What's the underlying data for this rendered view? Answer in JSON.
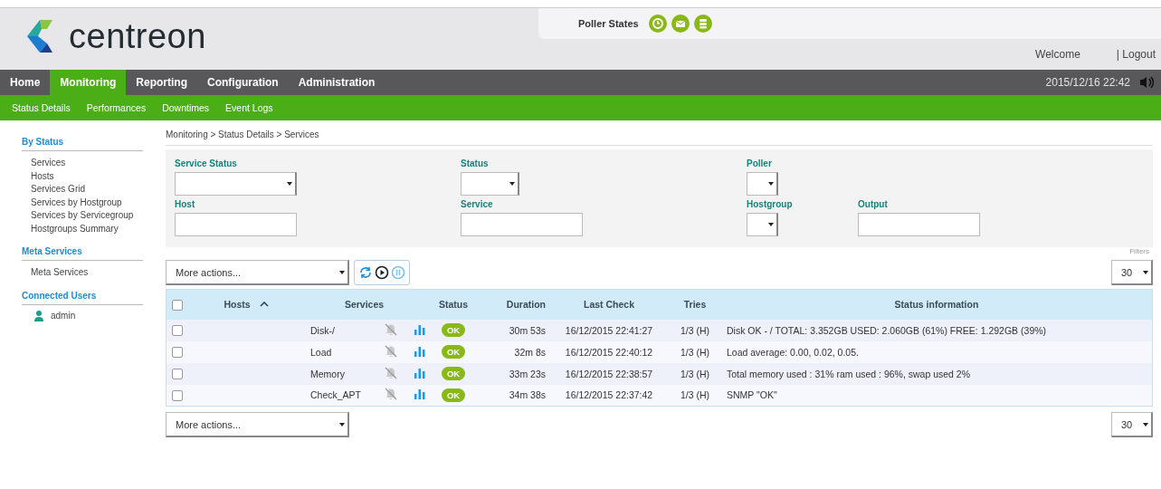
{
  "header": {
    "logo_text": "centreon",
    "poller_states": {
      "label": "Poller States"
    },
    "welcome": "Welcome",
    "logout": "| Logout"
  },
  "main_menu": [
    {
      "label": "Home",
      "selected": false
    },
    {
      "label": "Monitoring",
      "selected": true
    },
    {
      "label": "Reporting",
      "selected": false
    },
    {
      "label": "Configuration",
      "selected": false
    },
    {
      "label": "Administration",
      "selected": false
    }
  ],
  "clock": "2015/12/16 22:42",
  "sub_menu": [
    "Status Details",
    "Performances",
    "Downtimes",
    "Event Logs"
  ],
  "sidebar": [
    {
      "title": "By Status",
      "items": [
        "Services",
        "Hosts",
        "Services Grid",
        "Services by Hostgroup",
        "Services by Servicegroup",
        "Hostgroups Summary"
      ]
    },
    {
      "title": "Meta Services",
      "items": [
        "Meta Services"
      ]
    },
    {
      "title": "Connected Users",
      "users": [
        "admin"
      ]
    }
  ],
  "breadcrumb": "Monitoring > Status Details > Services",
  "filters": [
    {
      "label": "Service Status",
      "kind": "select"
    },
    {
      "label": "Status",
      "kind": "select"
    },
    {
      "label": "Poller",
      "kind": "select"
    },
    {
      "label": "Host",
      "kind": "input"
    },
    {
      "label": "Service",
      "kind": "input"
    },
    {
      "label": "Hostgroup",
      "kind": "select"
    },
    {
      "label": "Output",
      "kind": "input"
    }
  ],
  "filters_tab": "Filters",
  "actions_top": {
    "placeholder": "More actions...",
    "limit": "30"
  },
  "table": {
    "select_all_checked": false,
    "columns": [
      {
        "label": "Hosts",
        "sort_ascending": true
      },
      {
        "label": "Services"
      },
      {
        "label": "Status"
      },
      {
        "label": "Duration"
      },
      {
        "label": "Last Check"
      },
      {
        "label": "Tries"
      },
      {
        "label": "Status information"
      }
    ],
    "rows": [
      {
        "checked": false,
        "service": "Disk-/",
        "status": "OK",
        "color": "#88b917",
        "duration": "30m 53s",
        "last_check": "16/12/2015 22:41:27",
        "tries": "1/3 (H)",
        "info": "Disk OK - / TOTAL: 3.352GB USED: 2.060GB (61%) FREE: 1.292GB (39%)"
      },
      {
        "checked": false,
        "service": "Load",
        "status": "OK",
        "color": "#88b917",
        "duration": "32m 8s",
        "last_check": "16/12/2015 22:40:12",
        "tries": "1/3 (H)",
        "info": "Load average: 0.00, 0.02, 0.05."
      },
      {
        "checked": false,
        "service": "Memory",
        "status": "OK",
        "color": "#88b917",
        "duration": "33m 23s",
        "last_check": "16/12/2015 22:38:57",
        "tries": "1/3 (H)",
        "info": "Total memory used : 31% ram used : 96%, swap used 2%"
      },
      {
        "checked": false,
        "service": "Check_APT",
        "status": "OK",
        "color": "#88b917",
        "duration": "34m 38s",
        "last_check": "16/12/2015 22:37:42",
        "tries": "1/3 (H)",
        "info": "SNMP \"OK\""
      }
    ]
  },
  "actions_bottom": {
    "placeholder": "More actions...",
    "limit": "30"
  }
}
